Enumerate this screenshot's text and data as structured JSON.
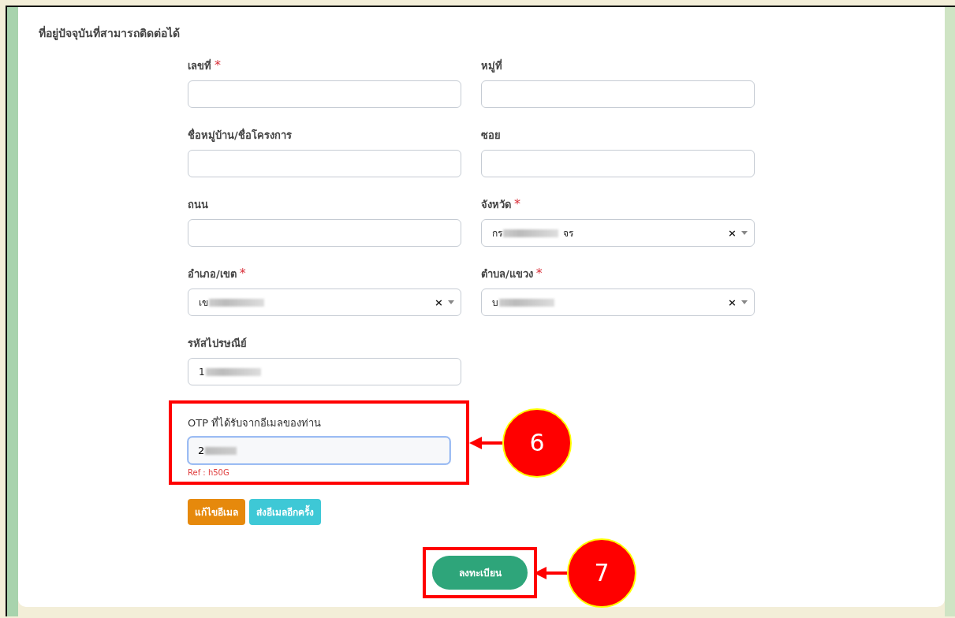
{
  "section_title": "ที่อยู่ปัจจุบันที่สามารถติดต่อได้",
  "fields": [
    {
      "kind": "text",
      "label": "เลขที่",
      "required_mark": "*"
    },
    {
      "kind": "text",
      "label": "หมู่ที่"
    },
    {
      "kind": "text",
      "label": "ชื่อหมู่บ้าน/ชื่อโครงการ"
    },
    {
      "kind": "text",
      "label": "ซอย"
    },
    {
      "kind": "text",
      "label": "ถนน"
    },
    {
      "kind": "select",
      "label": "จังหวัด",
      "required_mark": "*",
      "value": "กร",
      "value_end": "จร",
      "blurred": true,
      "clear": "×"
    },
    {
      "kind": "select",
      "label": "อำเภอ/เขต",
      "required_mark": "*",
      "value": "เข",
      "blurred": true,
      "clear": "×"
    },
    {
      "kind": "select",
      "label": "ตำบล/แขวง",
      "required_mark": "*",
      "value": "บ",
      "blurred": true,
      "clear": "×"
    },
    {
      "kind": "text",
      "label": "รหัสไปรษณีย์",
      "value": "1",
      "blurred": true
    }
  ],
  "otp": {
    "label": "OTP ที่ได้รับจากอีเมลของท่าน",
    "value": "2",
    "blurred": true,
    "focused": true,
    "ref": "Ref : h50G",
    "callout": "6"
  },
  "buttons": [
    {
      "label": "แก้ไขอีเมล",
      "kind": "warning"
    },
    {
      "label": "ส่งอีเมลอีกครั้ง",
      "kind": "info"
    }
  ],
  "submit": {
    "label": "ลงทะเบียน",
    "callout": "7"
  }
}
